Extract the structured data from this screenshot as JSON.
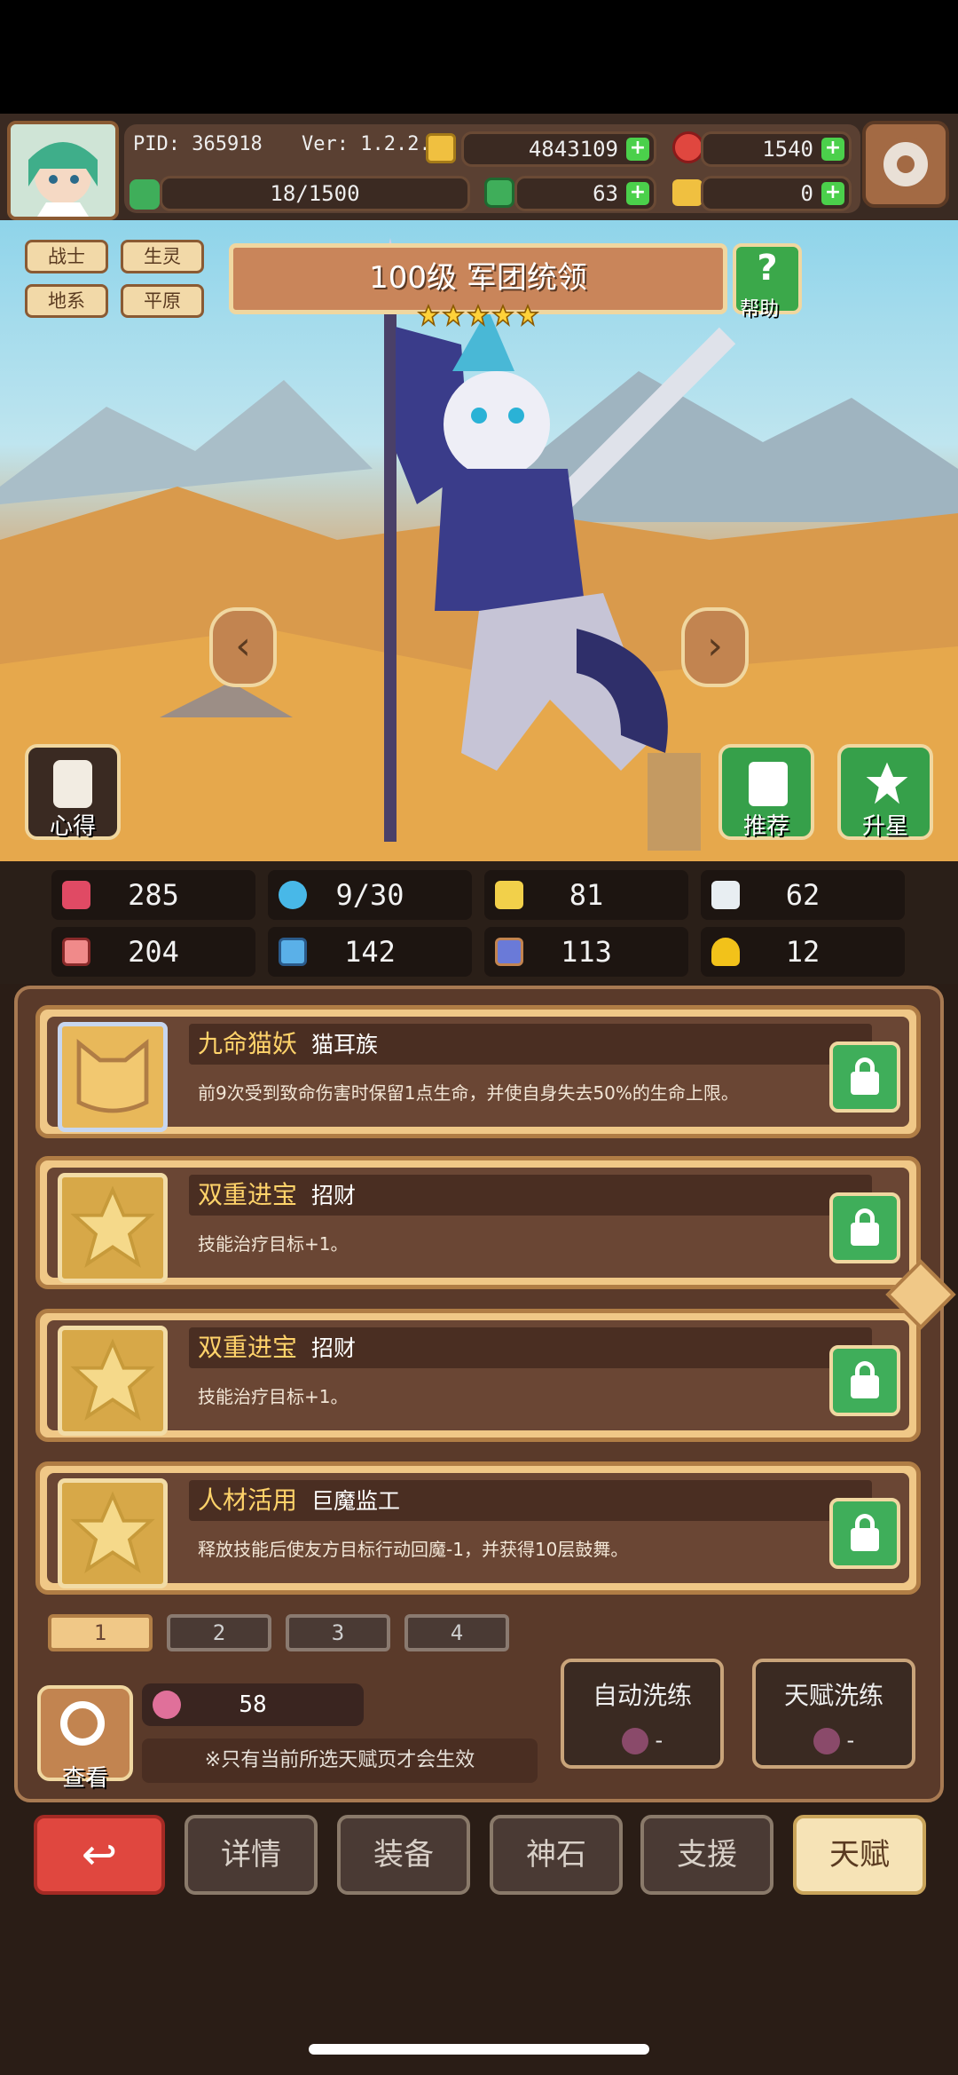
{
  "top": {
    "pid": "PID: 365918",
    "ver": "Ver: 1.2.2.1",
    "gold": "4843109",
    "gems": "1540",
    "energy": "18/1500",
    "clover": "63",
    "keys": "0"
  },
  "hero": {
    "tags": [
      "战士",
      "生灵",
      "地系",
      "平原"
    ],
    "title": "100级 军团统领",
    "stars": 5,
    "help_label": "帮助",
    "left_btn": "心得",
    "recommend": "推荐",
    "upstar": "升星"
  },
  "stats": [
    {
      "icon": "heart-icon",
      "value": "285"
    },
    {
      "icon": "drop-icon",
      "value": "9/30"
    },
    {
      "icon": "shield-icon",
      "value": "81"
    },
    {
      "icon": "wing-icon",
      "value": "62"
    },
    {
      "icon": "fist-icon",
      "value": "204"
    },
    {
      "icon": "book-icon",
      "value": "142"
    },
    {
      "icon": "boot-icon",
      "value": "113"
    },
    {
      "icon": "horseshoe-icon",
      "value": "12"
    }
  ],
  "talents": [
    {
      "name": "九命猫妖",
      "sub": "猫耳族",
      "desc": "前9次受到致命伤害时保留1点生命，并使自身失去50%的生命上限。"
    },
    {
      "name": "双重进宝",
      "sub": "招财",
      "desc": "技能治疗目标+1。"
    },
    {
      "name": "双重进宝",
      "sub": "招财",
      "desc": "技能治疗目标+1。"
    },
    {
      "name": "人材活用",
      "sub": "巨魔监工",
      "desc": "释放技能后使友方目标行动回魔-1，并获得10层鼓舞。"
    }
  ],
  "pages": [
    "1",
    "2",
    "3",
    "4"
  ],
  "bottom": {
    "view_label": "查看",
    "potion_count": "58",
    "note": "※只有当前所选天赋页才会生效",
    "auto_refine": "自动洗练",
    "talent_refine": "天赋洗练",
    "cost_dash": "-"
  },
  "nav": [
    "详情",
    "装备",
    "神石",
    "支援",
    "天赋"
  ],
  "colors": {
    "accent": "#f0c887",
    "green": "#3fae5a",
    "red": "#e0473f"
  }
}
